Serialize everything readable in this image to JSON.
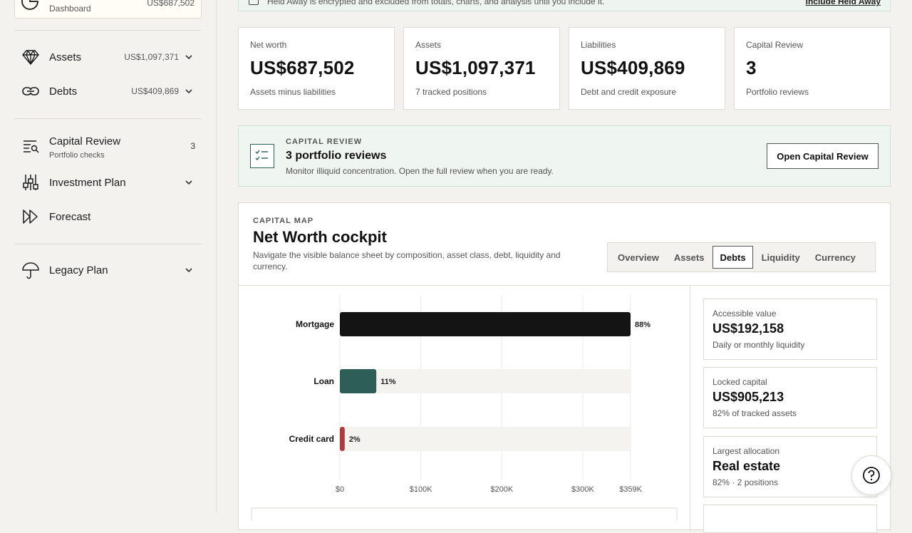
{
  "sidebar": {
    "dashboard": {
      "label": "Dashboard",
      "value": "US$687,502"
    },
    "items": [
      {
        "label": "Assets",
        "amount": "US$1,097,371",
        "icon": "diamond-icon"
      },
      {
        "label": "Debts",
        "amount": "US$409,869",
        "icon": "link-icon"
      },
      {
        "label": "Capital Review",
        "sub": "Portfolio checks",
        "count": "3",
        "icon": "review-icon"
      },
      {
        "label": "Investment Plan",
        "icon": "sliders-icon"
      },
      {
        "label": "Forecast",
        "icon": "fast-forward-icon"
      },
      {
        "label": "Legacy Plan",
        "icon": "umbrella-icon"
      }
    ]
  },
  "banner": {
    "text": "Held Away is encrypted and excluded from totals, charts, and analysis until you include it.",
    "link": "Include Held Away"
  },
  "stats": [
    {
      "title": "Net worth",
      "value": "US$687,502",
      "sub": "Assets minus liabilities"
    },
    {
      "title": "Assets",
      "value": "US$1,097,371",
      "sub": "7 tracked positions"
    },
    {
      "title": "Liabilities",
      "value": "US$409,869",
      "sub": "Debt and credit exposure"
    },
    {
      "title": "Capital Review",
      "value": "3",
      "sub": "Portfolio reviews"
    }
  ],
  "review": {
    "kicker": "CAPITAL REVIEW",
    "title": "3 portfolio reviews",
    "desc": "Monitor illiquid concentration. Open the full review when you are ready.",
    "button": "Open Capital Review"
  },
  "panel": {
    "kicker": "CAPITAL MAP",
    "title": "Net Worth cockpit",
    "desc": "Navigate the visible balance sheet by composition, asset class, debt, liquidity and currency.",
    "tabs": [
      "Overview",
      "Assets",
      "Debts",
      "Liquidity",
      "Currency"
    ],
    "active_tab": "Debts"
  },
  "side_cards": [
    {
      "title": "Accessible value",
      "value": "US$192,158",
      "sub": "Daily or monthly liquidity"
    },
    {
      "title": "Locked capital",
      "value": "US$905,213",
      "sub": "82% of tracked assets"
    },
    {
      "title": "Largest allocation",
      "value": "Real estate",
      "sub": "82% · 2 positions"
    }
  ],
  "chart_data": {
    "type": "bar",
    "orientation": "horizontal",
    "categories": [
      "Mortgage",
      "Loan",
      "Credit card"
    ],
    "percent_labels": [
      "88%",
      "11%",
      "2%"
    ],
    "values": [
      359000,
      45000,
      6000
    ],
    "xlim": [
      0,
      359000
    ],
    "x_ticks": [
      0,
      100000,
      200000,
      300000,
      359000
    ],
    "x_tick_labels": [
      "$0",
      "$100K",
      "$200K",
      "$300K",
      "$359K"
    ],
    "colors": [
      "#141414",
      "#2d5e57",
      "#b0393b"
    ],
    "track_color": "#f4f3ef",
    "grid": true
  },
  "colors": {
    "accent": "#2d5e57",
    "bg": "#f3f2ee"
  }
}
